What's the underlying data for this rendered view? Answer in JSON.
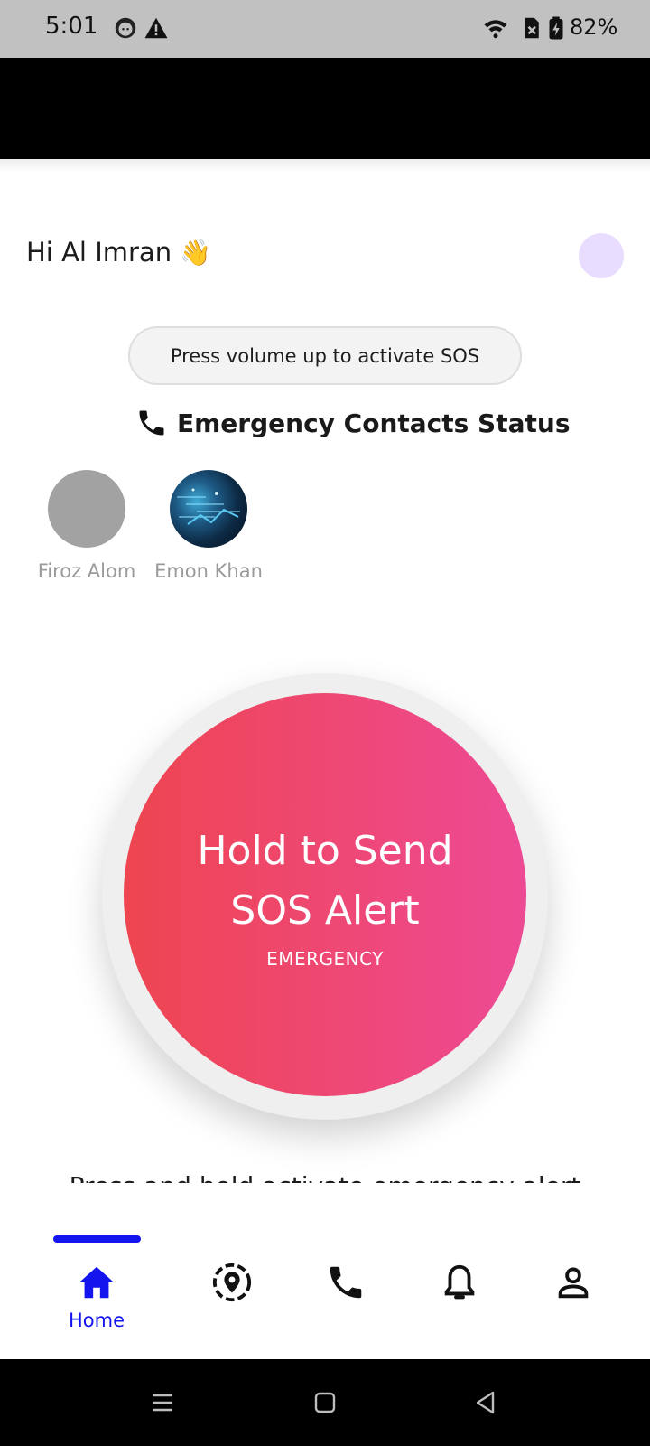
{
  "status_bar": {
    "time": "5:01",
    "battery": "82%",
    "icons": [
      "face-notification-icon",
      "warning-icon",
      "wifi-icon",
      "no-sim-icon",
      "battery-charging-icon"
    ]
  },
  "header": {
    "greeting": "Hi Al Imran",
    "wave": "👋"
  },
  "hint_pill": "Press volume up to activate SOS",
  "contacts": {
    "heading": "Emergency Contacts Status",
    "items": [
      {
        "name": "Firoz Alom",
        "avatar": "placeholder-gray"
      },
      {
        "name": "Emon Khan",
        "avatar": "tech-photo"
      }
    ]
  },
  "sos": {
    "title_line1": "Hold to Send",
    "title_line2": "SOS Alert",
    "subtitle": "EMERGENCY",
    "colors": {
      "start": "#ee4550",
      "end": "#ed4a95"
    }
  },
  "helper_text": "Press and hold activate emergency alert",
  "bottom_nav": {
    "active_color": "#1414ee",
    "items": [
      {
        "icon": "home-icon",
        "label": "Home",
        "active": true
      },
      {
        "icon": "location-icon",
        "label": "",
        "active": false
      },
      {
        "icon": "phone-icon",
        "label": "",
        "active": false
      },
      {
        "icon": "bell-icon",
        "label": "",
        "active": false
      },
      {
        "icon": "person-icon",
        "label": "",
        "active": false
      }
    ]
  }
}
